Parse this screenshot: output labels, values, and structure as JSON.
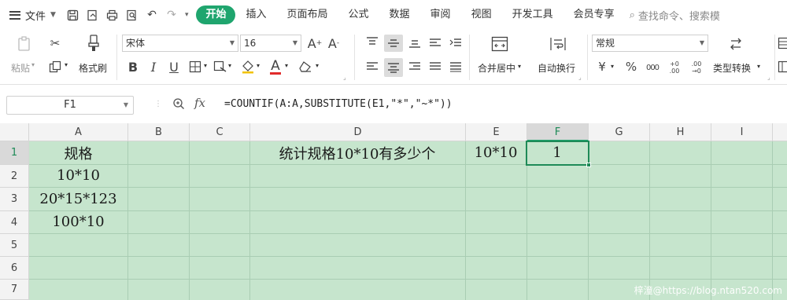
{
  "menu": {
    "file_label": "文件",
    "tabs": [
      "开始",
      "插入",
      "页面布局",
      "公式",
      "数据",
      "审阅",
      "视图",
      "开发工具",
      "会员专享"
    ],
    "active_tab_index": 0,
    "search_placeholder": "查找命令、搜索模"
  },
  "ribbon": {
    "paste_label": "粘贴",
    "format_painter_label": "格式刷",
    "font_name": "宋体",
    "font_size": "16",
    "merge_label": "合并居中",
    "wrap_label": "自动换行",
    "number_format": "常规",
    "convert_label": "类型转换",
    "currency_symbol": "¥",
    "percent_symbol": "%",
    "thousands_symbol": "000",
    "increase_decimal": "+0 .00",
    "decrease_decimal": ".00 →0"
  },
  "formula_bar": {
    "name_box": "F1",
    "fx_label": "fx",
    "formula": "=COUNTIF(A:A,SUBSTITUTE(E1,\"*\",\"~*\"))"
  },
  "grid": {
    "columns": [
      "A",
      "B",
      "C",
      "D",
      "E",
      "F",
      "G",
      "H",
      "I"
    ],
    "rows": [
      "1",
      "2",
      "3",
      "4",
      "5",
      "6",
      "7"
    ],
    "selected_column": "F",
    "selected_row": "1",
    "cells": {
      "A1": "规格",
      "A2": "10*10",
      "A3": "20*15*123",
      "A4": "100*10",
      "D1": "统计规格10*10有多少个",
      "E1": "10*10",
      "F1": "1"
    },
    "fill_color": "#c6e5cd",
    "accent_color": "#1fa56e"
  },
  "watermark": "梓潼@https://blog.ntan520.com"
}
